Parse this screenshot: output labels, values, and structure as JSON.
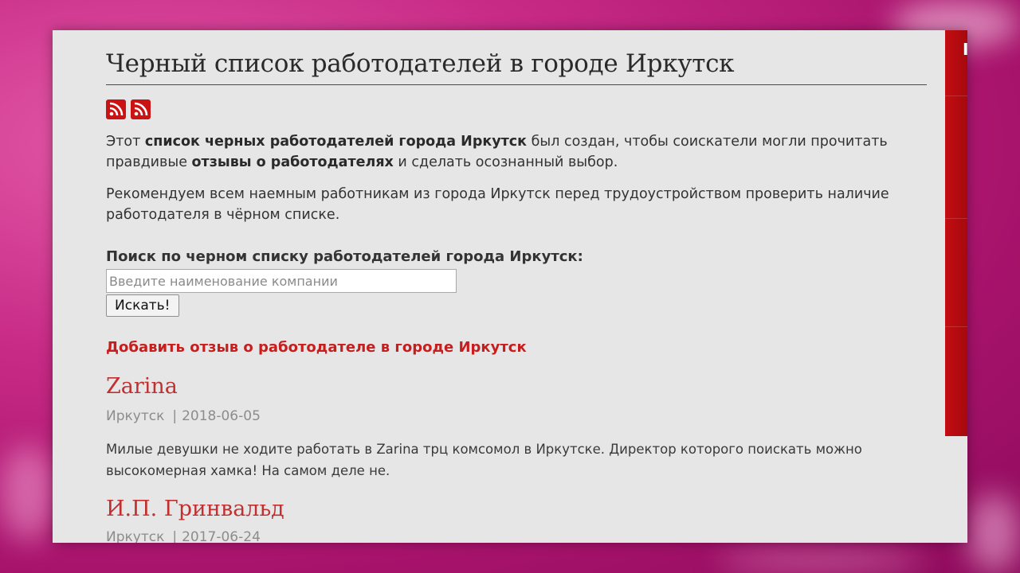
{
  "page": {
    "title": "Черный список работодателей в городе Иркутск",
    "intro": {
      "text1": "Этот ",
      "bold1": "список черных работодателей города Иркутск",
      "text2": " был создан, чтобы соискатели могли прочитать правдивые ",
      "bold2": "отзывы о работодателях",
      "text3": " и сделать осознанный выбор."
    },
    "recommendation": "Рекомендуем всем наемным работникам из города Иркутск перед трудоустройством проверить наличие работодателя в чёрном списке."
  },
  "feeds": [
    {
      "icon": "rss-icon"
    },
    {
      "icon": "rss-icon"
    }
  ],
  "search": {
    "label": "Поиск по черном списку работодателей города Иркутск:",
    "placeholder": "Введите наименование компании",
    "value": "",
    "button_label": "Искать!"
  },
  "add_review_link": "Добавить отзыв о работодателе в городе Иркутск",
  "reviews": [
    {
      "company": "Zarina",
      "city": "Иркутск",
      "date": "2018-06-05",
      "text": "Милые девушки не ходите работать в Zarina трц комсомол в Иркутске. Директор которого поискать можно высокомерная хамка! На самом деле не."
    },
    {
      "company": "И.П. Гринвальд",
      "city": "Иркутск",
      "date": "2017-06-24"
    }
  ],
  "sidebar": {
    "letter": "I"
  },
  "colors": {
    "accent_red": "#c81d1d",
    "rss_red": "#cc1313",
    "sidebar_red": "#b30b10",
    "page_bg": "#e6e6e6",
    "backdrop_pink": "#c82b86"
  },
  "separator": "|"
}
